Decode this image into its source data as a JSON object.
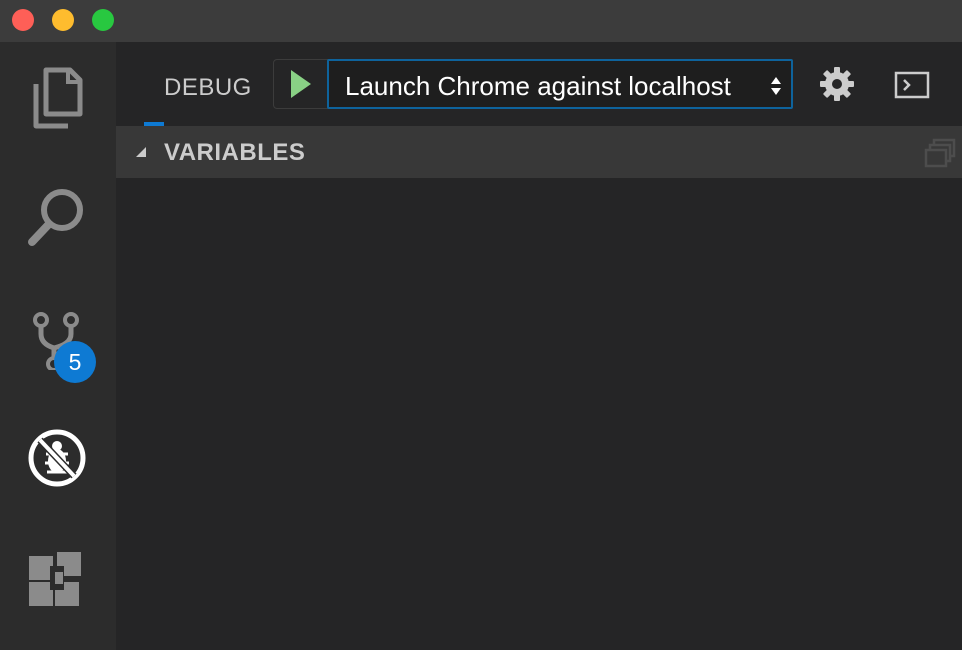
{
  "window": {
    "title": ""
  },
  "activity_bar": {
    "items": [
      {
        "icon": "files-icon"
      },
      {
        "icon": "search-icon"
      },
      {
        "icon": "source-control-icon",
        "badge": "5"
      },
      {
        "icon": "debug-icon"
      },
      {
        "icon": "extensions-icon"
      }
    ]
  },
  "debug": {
    "title": "DEBUG",
    "config": {
      "selected": "Launch Chrome against localhost"
    },
    "actions": [
      "start-debugging-icon",
      "gear-icon",
      "debug-console-icon"
    ]
  },
  "sections": [
    {
      "title": "VARIABLES",
      "expanded": true
    }
  ],
  "colors": {
    "accent": "#0e7ad3",
    "play": "#89d185",
    "background": "#252526"
  }
}
